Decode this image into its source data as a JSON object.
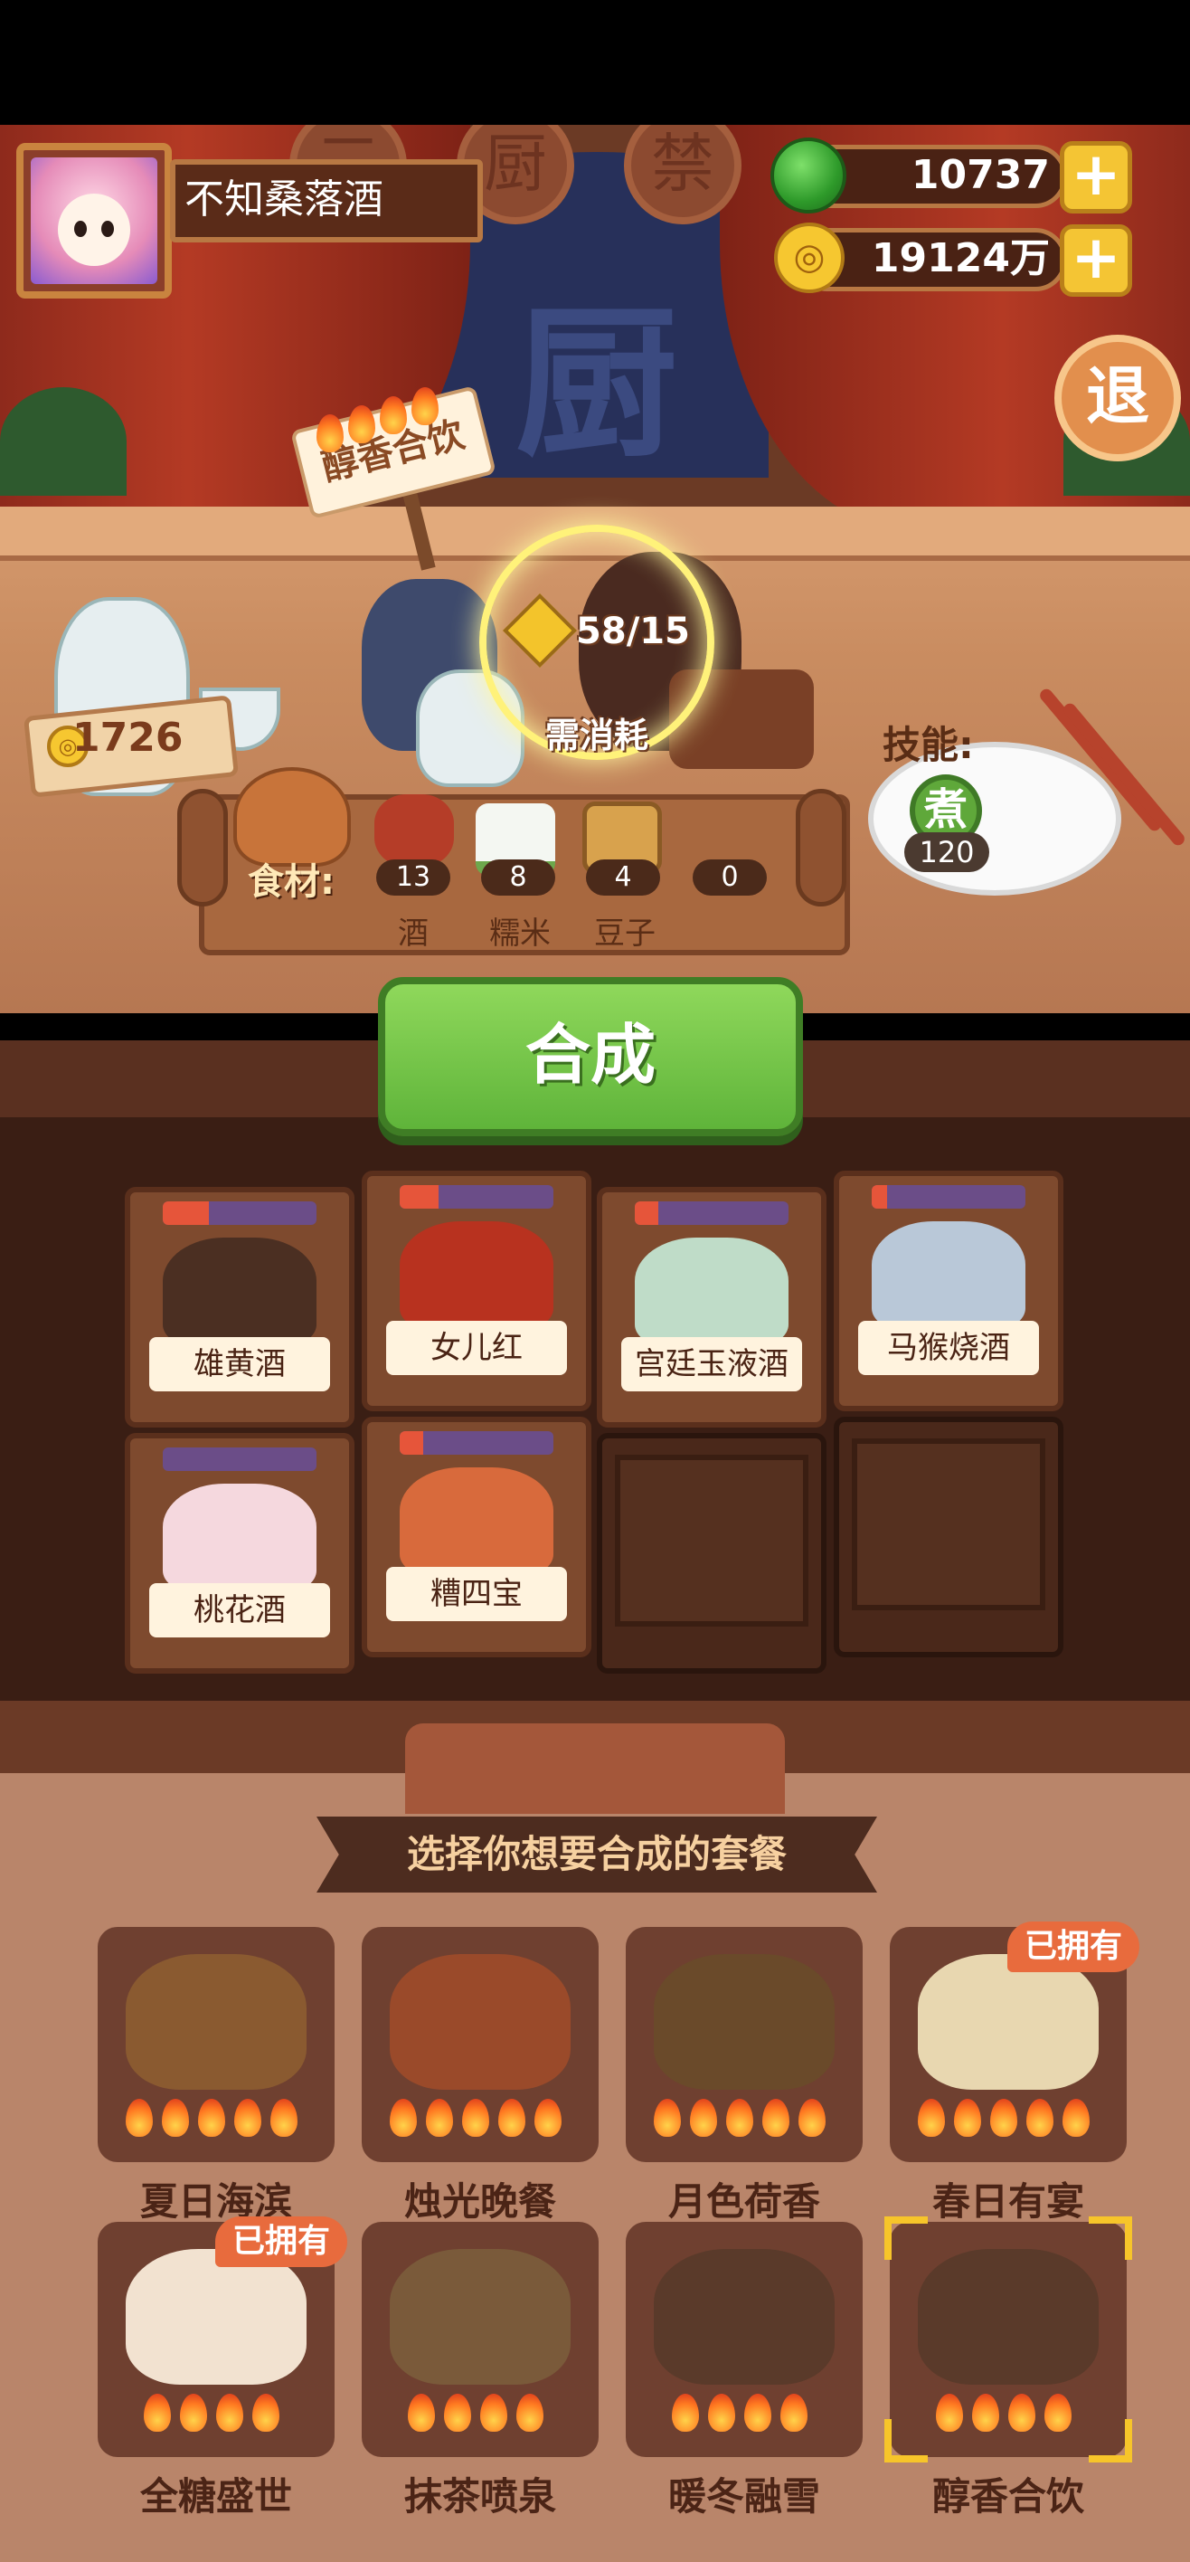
{
  "player": {
    "name": "不知桑落酒"
  },
  "currency": {
    "jade": "10737",
    "coins": "19124万"
  },
  "buttons": {
    "plus": "+",
    "exit": "退",
    "synthesize": "合成"
  },
  "stage": {
    "medallions": [
      "三",
      "厨",
      "禁"
    ],
    "backdrop_char": "厨"
  },
  "dish": {
    "name": "醇香合饮",
    "flames": 4,
    "progress": "58/15",
    "consume_label": "需消耗",
    "price": "1726"
  },
  "skill": {
    "label": "技能:",
    "name": "煮",
    "value": "120"
  },
  "ingredients": {
    "label": "食材:",
    "items": [
      {
        "name": "酒",
        "count": "13"
      },
      {
        "name": "糯米",
        "count": "8"
      },
      {
        "name": "豆子",
        "count": "4"
      },
      {
        "name": "",
        "count": "0"
      }
    ]
  },
  "shelf": [
    {
      "name": "雄黄酒",
      "progress": 0.3
    },
    {
      "name": "女儿红",
      "progress": 0.25
    },
    {
      "name": "宫廷玉液酒",
      "progress": 0.15
    },
    {
      "name": "马猴烧酒",
      "progress": 0.1
    },
    {
      "name": "桃花酒",
      "progress": 0.0
    },
    {
      "name": "糟四宝",
      "progress": 0.15
    },
    {
      "name": ""
    },
    {
      "name": ""
    }
  ],
  "picker": {
    "banner": "选择你想要合成的套餐",
    "owned_label": "已拥有",
    "meals": [
      {
        "name": "夏日海滨",
        "flames": 5,
        "owned": false
      },
      {
        "name": "烛光晚餐",
        "flames": 5,
        "owned": false
      },
      {
        "name": "月色荷香",
        "flames": 5,
        "owned": false
      },
      {
        "name": "春日有宴",
        "flames": 5,
        "owned": true
      },
      {
        "name": "全糖盛世",
        "flames": 4,
        "owned": true
      },
      {
        "name": "抹茶喷泉",
        "flames": 4,
        "owned": false
      },
      {
        "name": "暖冬融雪",
        "flames": 4,
        "owned": false
      },
      {
        "name": "醇香合饮",
        "flames": 4,
        "owned": false,
        "selected": true
      }
    ]
  },
  "colors": {
    "accent_green": "#5fb43a",
    "gold": "#f4c534",
    "owned_badge": "#e86b3d"
  }
}
